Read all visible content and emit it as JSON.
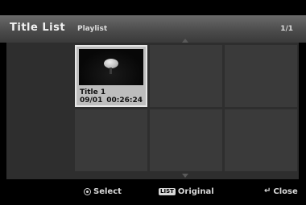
{
  "header": {
    "title": "Title List",
    "subtitle": "Playlist",
    "page": "1/1"
  },
  "grid": {
    "selected_item": {
      "title": "Title 1",
      "date": "09/01",
      "duration": "00:26:24"
    }
  },
  "footer": {
    "select_label": "Select",
    "list_icon_label": "LIST",
    "original_label": "Original",
    "close_label": "Close"
  },
  "icons": {
    "select": "enter-circle-icon",
    "list": "list-button-icon",
    "close": "return-arrow-icon",
    "scroll_up": "triangle-up-icon",
    "scroll_down": "triangle-down-icon"
  }
}
